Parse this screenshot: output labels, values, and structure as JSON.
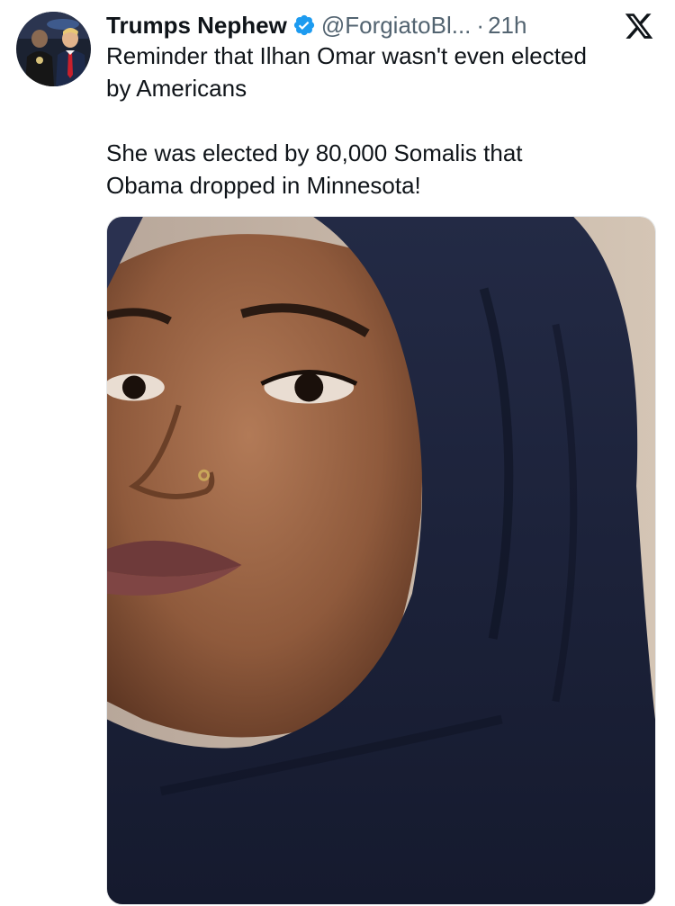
{
  "post": {
    "display_name": "Trumps Nephew",
    "handle": "@ForgiatoBl...",
    "separator": "·",
    "timestamp": "21h",
    "verified_icon": "verified-badge-icon",
    "verified_color": "#1d9bf0",
    "platform_logo": "x-logo-icon",
    "text_line_1": "Reminder that Ilhan Omar wasn't even elected",
    "text_line_2": "by Americans",
    "text_line_3": "She was elected by 80,000 Somalis that",
    "text_line_4": "Obama dropped in Minnesota!"
  },
  "colors": {
    "text_primary": "#0f1419",
    "text_secondary": "#536471",
    "background": "#ffffff"
  }
}
